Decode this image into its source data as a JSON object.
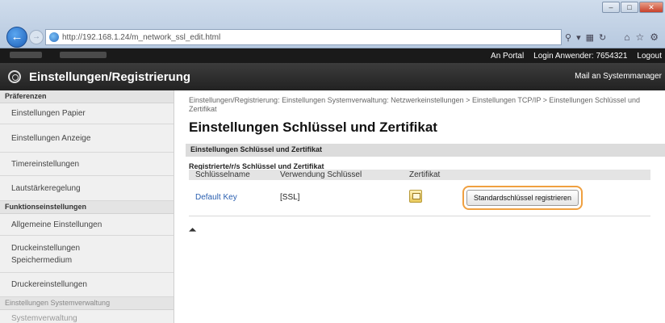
{
  "browser": {
    "url": "http://192.168.1.24/m_network_ssl_edit.html",
    "window_buttons": [
      "–",
      "□",
      "✕"
    ]
  },
  "topbar": {
    "to_portal": "An Portal",
    "login_user": "Login Anwender:",
    "user_id": "7654321",
    "logout": "Logout"
  },
  "header": {
    "title": "Einstellungen/Registrierung",
    "mail_admin": "Mail an Systemmanager"
  },
  "sidebar": {
    "sections": [
      {
        "heading": "Präferenzen",
        "items": [
          "Einstellungen Papier",
          "Einstellungen Anzeige",
          "Timereinstellungen",
          "Lautstärkeregelung"
        ]
      },
      {
        "heading": "Funktionseinstellungen",
        "items": [
          "Allgemeine Einstellungen",
          "Druckeinstellungen Speichermedium",
          "Druckereinstellungen"
        ]
      },
      {
        "heading": "Einstellungen Systemverwaltung",
        "items": [
          "Systemverwaltung"
        ]
      }
    ]
  },
  "main": {
    "breadcrumb": "Einstellungen/Registrierung: Einstellungen Systemverwaltung: Netzwerkeinstellungen > Einstellungen TCP/IP > Einstellungen Schlüssel und Zertifikat",
    "title": "Einstellungen Schlüssel und Zertifikat",
    "section": "Einstellungen Schlüssel und Zertifikat",
    "subsection": "Registrierte/r/s Schlüssel und Zertifikat",
    "table": {
      "headers": [
        "Schlüsselname",
        "Verwendung Schlüssel",
        "Zertifikat",
        ""
      ],
      "rows": [
        {
          "key_name": "Default Key",
          "usage": "[SSL]",
          "button": "Standardschlüssel registrieren"
        }
      ]
    }
  }
}
